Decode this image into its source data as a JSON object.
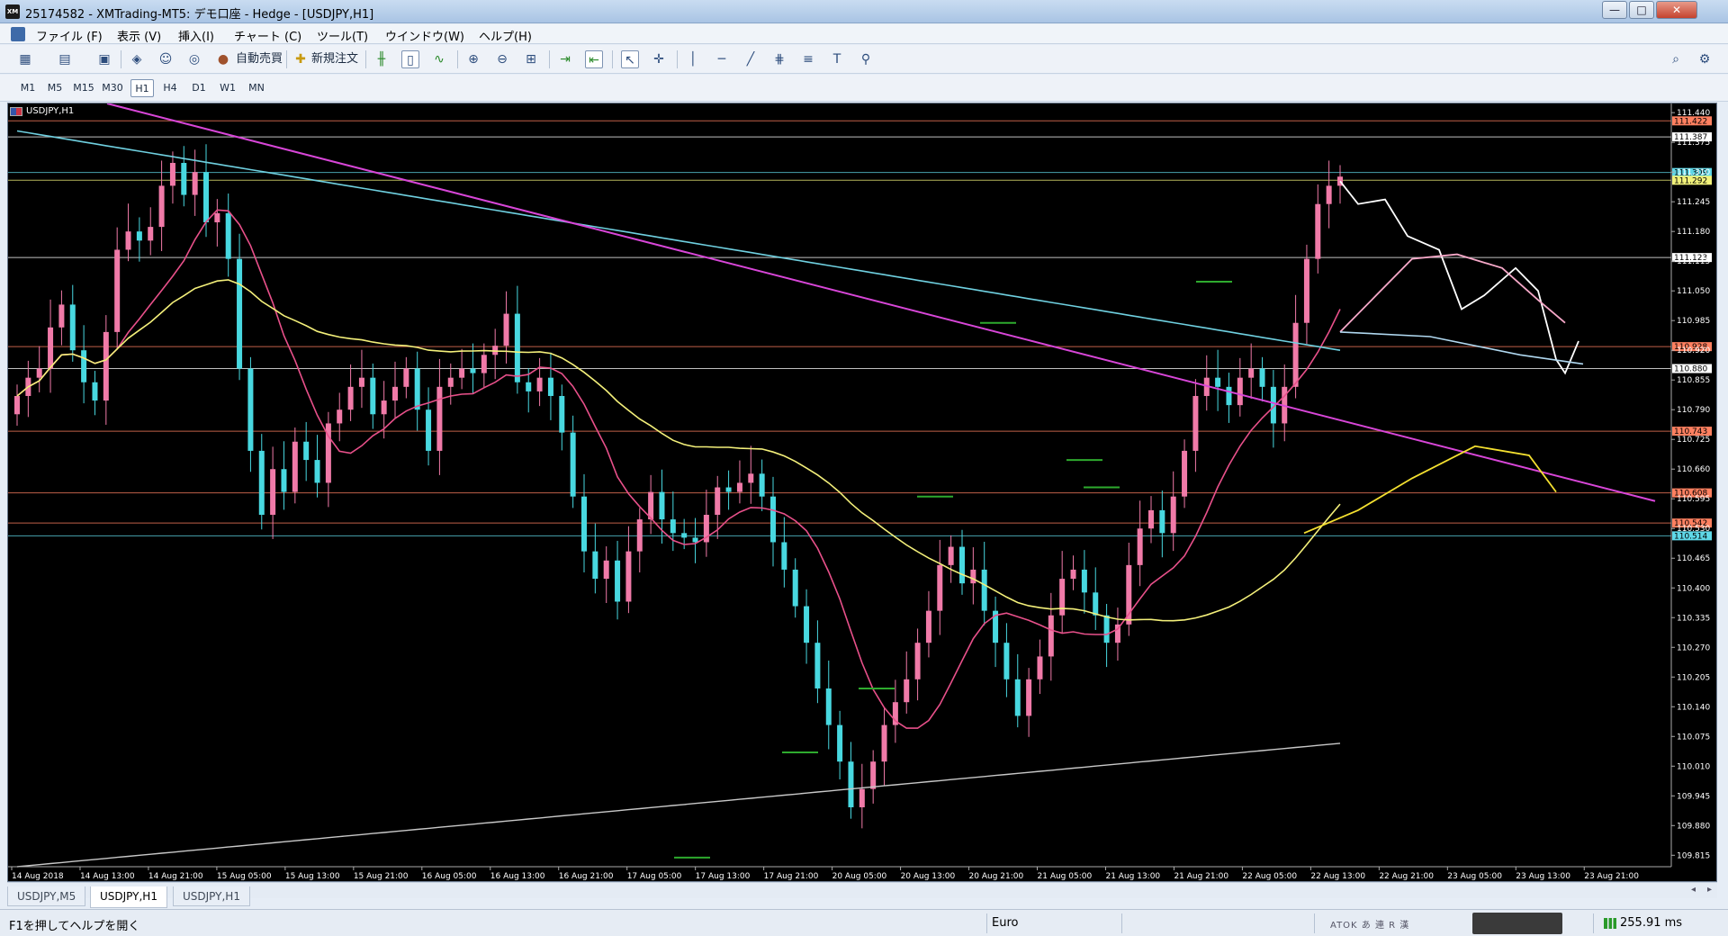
{
  "window": {
    "title": "25174582 - XMTrading-MT5: デモ口座 - Hedge - [USDJPY,H1]",
    "app_icon": "XM",
    "controls": {
      "minimize": "—",
      "maximize": "□",
      "close": "✕"
    }
  },
  "menu": {
    "items": [
      "ファイル (F)",
      "表示 (V)",
      "挿入(I)",
      "チャート (C)",
      "ツール(T)",
      "ウインドウ(W)",
      "ヘルプ(H)"
    ]
  },
  "toolbar": {
    "auto_trade_label": "自動売買",
    "new_order_label": "新規注文"
  },
  "timeframes": [
    "M1",
    "M5",
    "M15",
    "M30",
    "H1",
    "H4",
    "D1",
    "W1",
    "MN"
  ],
  "timeframe_active": "H1",
  "chart": {
    "symbol_label": "USDJPY,H1",
    "background": "#000000",
    "up_candle_color": "#f07aa8",
    "down_candle_color": "#48d8e0"
  },
  "chart_data": {
    "type": "candlestick",
    "symbol": "USDJPY",
    "timeframe": "H1",
    "y_ticks": [
      "111.440",
      "111.375",
      "111.310",
      "111.245",
      "111.180",
      "111.115",
      "111.050",
      "110.985",
      "110.920",
      "110.855",
      "110.790",
      "110.725",
      "110.660",
      "110.595",
      "110.530",
      "110.465",
      "110.400",
      "110.335",
      "110.270",
      "110.205",
      "110.140",
      "110.075",
      "110.010",
      "109.945",
      "109.880",
      "109.815"
    ],
    "ylim": [
      109.79,
      111.46
    ],
    "x_ticks": [
      "14 Aug 2018",
      "14 Aug 13:00",
      "14 Aug 21:00",
      "15 Aug 05:00",
      "15 Aug 13:00",
      "15 Aug 21:00",
      "16 Aug 05:00",
      "16 Aug 13:00",
      "16 Aug 21:00",
      "17 Aug 05:00",
      "17 Aug 13:00",
      "17 Aug 21:00",
      "20 Aug 05:00",
      "20 Aug 13:00",
      "20 Aug 21:00",
      "21 Aug 05:00",
      "21 Aug 13:00",
      "21 Aug 21:00",
      "22 Aug 05:00",
      "22 Aug 13:00",
      "22 Aug 21:00",
      "23 Aug 05:00",
      "23 Aug 13:00",
      "23 Aug 21:00"
    ],
    "price_labels": [
      {
        "text": "111.422",
        "value": 111.422,
        "color": "#ff8060"
      },
      {
        "text": "111.387",
        "value": 111.387,
        "color": "#ffffff"
      },
      {
        "text": "111.309",
        "value": 111.309,
        "color": "#5fd8e8"
      },
      {
        "text": "111.292",
        "value": 111.292,
        "color": "#f2f27a"
      },
      {
        "text": "111.123",
        "value": 111.123,
        "color": "#ffffff"
      },
      {
        "text": "110.928",
        "value": 110.928,
        "color": "#ff8060"
      },
      {
        "text": "110.880",
        "value": 110.88,
        "color": "#ffffff"
      },
      {
        "text": "110.743",
        "value": 110.743,
        "color": "#ff8060"
      },
      {
        "text": "110.608",
        "value": 110.608,
        "color": "#ff8060"
      },
      {
        "text": "110.542",
        "value": 110.542,
        "color": "#ff8060"
      },
      {
        "text": "110.514",
        "value": 110.514,
        "color": "#5fd8e8"
      }
    ],
    "close_series": [
      110.82,
      110.86,
      110.88,
      110.97,
      111.02,
      110.92,
      110.85,
      110.81,
      110.96,
      111.14,
      111.18,
      111.16,
      111.19,
      111.28,
      111.33,
      111.26,
      111.31,
      111.2,
      111.22,
      111.12,
      110.88,
      110.7,
      110.56,
      110.66,
      110.61,
      110.72,
      110.68,
      110.63,
      110.76,
      110.79,
      110.84,
      110.86,
      110.78,
      110.81,
      110.84,
      110.88,
      110.79,
      110.7,
      110.84,
      110.86,
      110.88,
      110.87,
      110.91,
      110.93,
      111.0,
      110.85,
      110.83,
      110.86,
      110.82,
      110.74,
      110.6,
      110.48,
      110.42,
      110.46,
      110.37,
      110.48,
      110.55,
      110.61,
      110.55,
      110.52,
      110.51,
      110.5,
      110.56,
      110.62,
      110.61,
      110.63,
      110.65,
      110.6,
      110.5,
      110.44,
      110.36,
      110.28,
      110.18,
      110.1,
      110.02,
      109.92,
      109.96,
      110.02,
      110.1,
      110.15,
      110.2,
      110.28,
      110.35,
      110.45,
      110.49,
      110.41,
      110.44,
      110.35,
      110.28,
      110.2,
      110.12,
      110.2,
      110.25,
      110.34,
      110.42,
      110.44,
      110.39,
      110.34,
      110.28,
      110.32,
      110.45,
      110.53,
      110.57,
      110.52,
      110.6,
      110.7,
      110.82,
      110.86,
      110.84,
      110.8,
      110.86,
      110.88,
      110.84,
      110.76,
      110.84,
      110.98,
      111.12,
      111.24,
      111.28,
      111.3
    ],
    "indicators": [
      {
        "name": "MA fast",
        "color": "#e8508a"
      },
      {
        "name": "MA medium",
        "color": "#f4f07a"
      },
      {
        "name": "MA slow",
        "color": "#6fd0e0"
      },
      {
        "name": "MA long",
        "color": "#c8c8c8"
      },
      {
        "name": "trendline",
        "color": "#d846d8"
      }
    ]
  },
  "tabs": [
    "USDJPY,M5",
    "USDJPY,H1",
    "USDJPY,H1"
  ],
  "tab_active_index": 1,
  "status": {
    "help_text": "F1を押してヘルプを開く",
    "profile": "Euro",
    "ping": "255.91 ms",
    "ime": "ATOK あ 連 R 漢"
  }
}
